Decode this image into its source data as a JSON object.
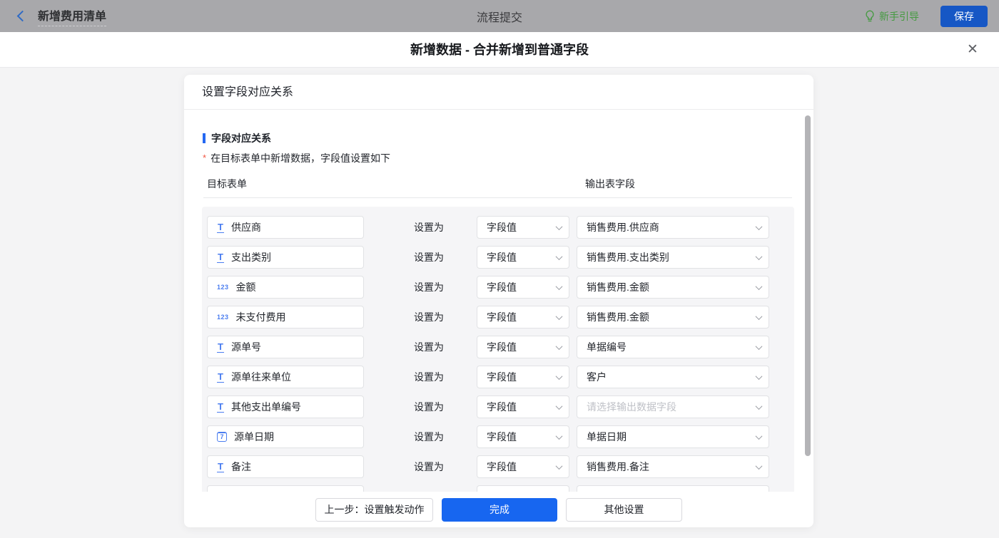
{
  "colors": {
    "topbar_bg": "#a8a8ab",
    "save_button_blue": "#1657c5",
    "guide_green": "#459a41",
    "section_bar_blue": "#2468f2",
    "done_button_blue": "#1766f0",
    "required_red": "#f25643",
    "field_icon_blue": "#4a7df0"
  },
  "topbar": {
    "back_label": "新增费用清单",
    "center_title": "流程提交",
    "guide_label": "新手引导",
    "save_label": "保存"
  },
  "dialog": {
    "title": "新增数据 - 合并新增到普通字段",
    "close_glyph": "✕",
    "panel_header": "设置字段对应关系",
    "section": {
      "title": "字段对应关系",
      "required_mark": "*",
      "note": "在目标表单中新增数据，字段值设置如下",
      "col_target": "目标表单",
      "col_output": "输出表字段"
    },
    "set_as_label": "设置为",
    "output_placeholder": "请选择输出数据字段",
    "rows": [
      {
        "icon": "text-icon",
        "field": "供应商",
        "mode": "字段值",
        "output": "销售费用.供应商"
      },
      {
        "icon": "text-icon",
        "field": "支出类别",
        "mode": "字段值",
        "output": "销售费用.支出类别"
      },
      {
        "icon": "number-icon",
        "field": "金额",
        "mode": "字段值",
        "output": "销售费用.金额"
      },
      {
        "icon": "number-icon",
        "field": "未支付费用",
        "mode": "字段值",
        "output": "销售费用.金额"
      },
      {
        "icon": "text-icon",
        "field": "源单号",
        "mode": "字段值",
        "output": "单据编号"
      },
      {
        "icon": "text-icon",
        "field": "源单往来单位",
        "mode": "字段值",
        "output": "客户"
      },
      {
        "icon": "text-icon",
        "field": "其他支出单编号",
        "mode": "字段值",
        "output": ""
      },
      {
        "icon": "date-icon",
        "field": "源单日期",
        "mode": "字段值",
        "output": "单据日期"
      },
      {
        "icon": "text-icon",
        "field": "备注",
        "mode": "字段值",
        "output": "销售费用.备注"
      }
    ],
    "footer": {
      "prev_label": "上一步：设置触发动作",
      "done_label": "完成",
      "other_label": "其他设置"
    }
  },
  "icon_glyphs": {
    "text-icon": "T",
    "number-icon": "123",
    "date-icon": "7"
  }
}
